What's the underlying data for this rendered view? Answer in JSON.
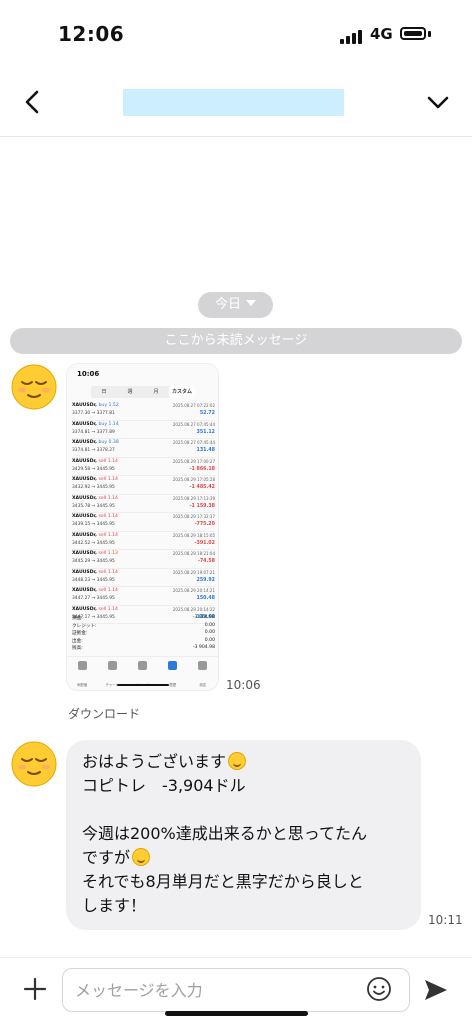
{
  "status_bar": {
    "time": "12:06",
    "network": "4G"
  },
  "chat": {
    "date_chip": "今日",
    "unread_divider": "ここから未読メッセージ",
    "image_message": {
      "time": "10:06",
      "download_label": "ダウンロード",
      "screenshot": {
        "status_time": "10:06",
        "segments": [
          "日",
          "週",
          "月",
          "カスタム"
        ],
        "active_segment": "カスタム",
        "trades": [
          {
            "symbol": "XAUUSDr",
            "side": "buy",
            "lots": "1.52",
            "prices": "3377.30 → 3377.81",
            "datetime": "2025.08.27 07:22:02",
            "profit": "52.72"
          },
          {
            "symbol": "XAUUSDr",
            "side": "buy",
            "lots": "1.14",
            "prices": "3374.81 → 3377.89",
            "datetime": "2025.08.27 07:45:44",
            "profit": "351.12"
          },
          {
            "symbol": "XAUUSDr",
            "side": "buy",
            "lots": "0.38",
            "prices": "3374.81 → 3378.27",
            "datetime": "2025.08.27 07:45:44",
            "profit": "131.48"
          },
          {
            "symbol": "XAUUSDr",
            "side": "sell",
            "lots": "1.14",
            "prices": "3429.58 → 3445.95",
            "datetime": "2025.08.29 17:00:27",
            "profit": "-1 866.18"
          },
          {
            "symbol": "XAUUSDr",
            "side": "sell",
            "lots": "1.14",
            "prices": "3432.92 → 3445.95",
            "datetime": "2025.08.29 17:05:28",
            "profit": "-1 485.42"
          },
          {
            "symbol": "XAUUSDr",
            "side": "sell",
            "lots": "1.14",
            "prices": "3435.78 → 3445.95",
            "datetime": "2025.08.29 17:13:39",
            "profit": "-1 159.38"
          },
          {
            "symbol": "XAUUSDr",
            "side": "sell",
            "lots": "1.14",
            "prices": "3439.15 → 3445.95",
            "datetime": "2025.08.29 17:32:37",
            "profit": "-775.20"
          },
          {
            "symbol": "XAUUSDr",
            "side": "sell",
            "lots": "1.14",
            "prices": "3442.52 → 3445.95",
            "datetime": "2025.08.29 18:15:05",
            "profit": "-391.02"
          },
          {
            "symbol": "XAUUSDr",
            "side": "sell",
            "lots": "1.13",
            "prices": "3445.29 → 3445.95",
            "datetime": "2025.08.29 18:21:04",
            "profit": "-74.58"
          },
          {
            "symbol": "XAUUSDr",
            "side": "sell",
            "lots": "1.14",
            "prices": "3448.23 → 3445.95",
            "datetime": "2025.08.29 19:07:21",
            "profit": "259.92"
          },
          {
            "symbol": "XAUUSDr",
            "side": "sell",
            "lots": "1.14",
            "prices": "3447.27 → 3445.95",
            "datetime": "2025.08.29 20:14:21",
            "profit": "150.48"
          },
          {
            "symbol": "XAUUSDr",
            "side": "sell",
            "lots": "1.14",
            "prices": "3447.17 → 3445.95",
            "datetime": "2025.08.29 20:14:22",
            "profit": "139.08"
          }
        ],
        "summary": [
          {
            "label": "損益:",
            "value": "-3 904.98"
          },
          {
            "label": "クレジット:",
            "value": "0.00"
          },
          {
            "label": "証拠金:",
            "value": "0.00"
          },
          {
            "label": "出金:",
            "value": "0.00"
          },
          {
            "label": "残高:",
            "value": "-3 904.98"
          }
        ],
        "tabs": [
          "気配値",
          "チャート",
          "トレード",
          "履歴",
          "設定"
        ],
        "active_tab": "履歴"
      }
    },
    "text_message": {
      "time": "10:11",
      "lines": [
        "おはようございます",
        "コピトレ　-3,904ドル",
        "",
        "今週は200%達成出来るかと思ってたん",
        "ですが",
        "それでも8月単月だと黒字だから良しと",
        "します！"
      ]
    }
  },
  "input_bar": {
    "placeholder": "メッセージを入力"
  },
  "colors": {
    "buy": "#2a7bd8",
    "sell": "#e04848",
    "chip_bg": "#d4d4d6",
    "bubble_bg": "#f0f0f2"
  },
  "icons": [
    "back-chevron-icon",
    "chevron-down-icon",
    "plus-icon",
    "emoji-icon",
    "send-icon"
  ]
}
